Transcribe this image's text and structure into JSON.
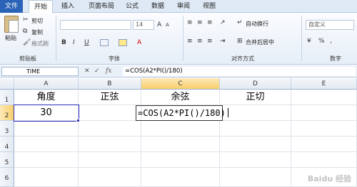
{
  "tabs": [
    "文件",
    "开始",
    "插入",
    "页面布局",
    "公式",
    "数据",
    "审阅",
    "视图"
  ],
  "clipboard": {
    "paste": "粘贴",
    "cut": "剪切",
    "copy": "复制",
    "format_painter": "格式刷",
    "group": "剪贴板"
  },
  "font": {
    "size": "14",
    "group": "字体"
  },
  "alignment": {
    "wrap": "自动换行",
    "merge": "合并后居中",
    "group": "对齐方式"
  },
  "number": {
    "format": "自定义",
    "group": "数字"
  },
  "formula_bar": {
    "name_box": "TIME",
    "fx": "fx",
    "formula": "=COS(A2*PI()/180)"
  },
  "columns": [
    "A",
    "B",
    "C",
    "D",
    "E"
  ],
  "rows": [
    "1",
    "2",
    "3",
    "4",
    "5",
    "6"
  ],
  "cells": {
    "A1": "角度",
    "B1": "正弦",
    "C1": "余弦",
    "D1": "正切",
    "A2": "30",
    "B2_edit": "=COS(A2*PI()/180)"
  },
  "watermark": "Baidu 经验"
}
